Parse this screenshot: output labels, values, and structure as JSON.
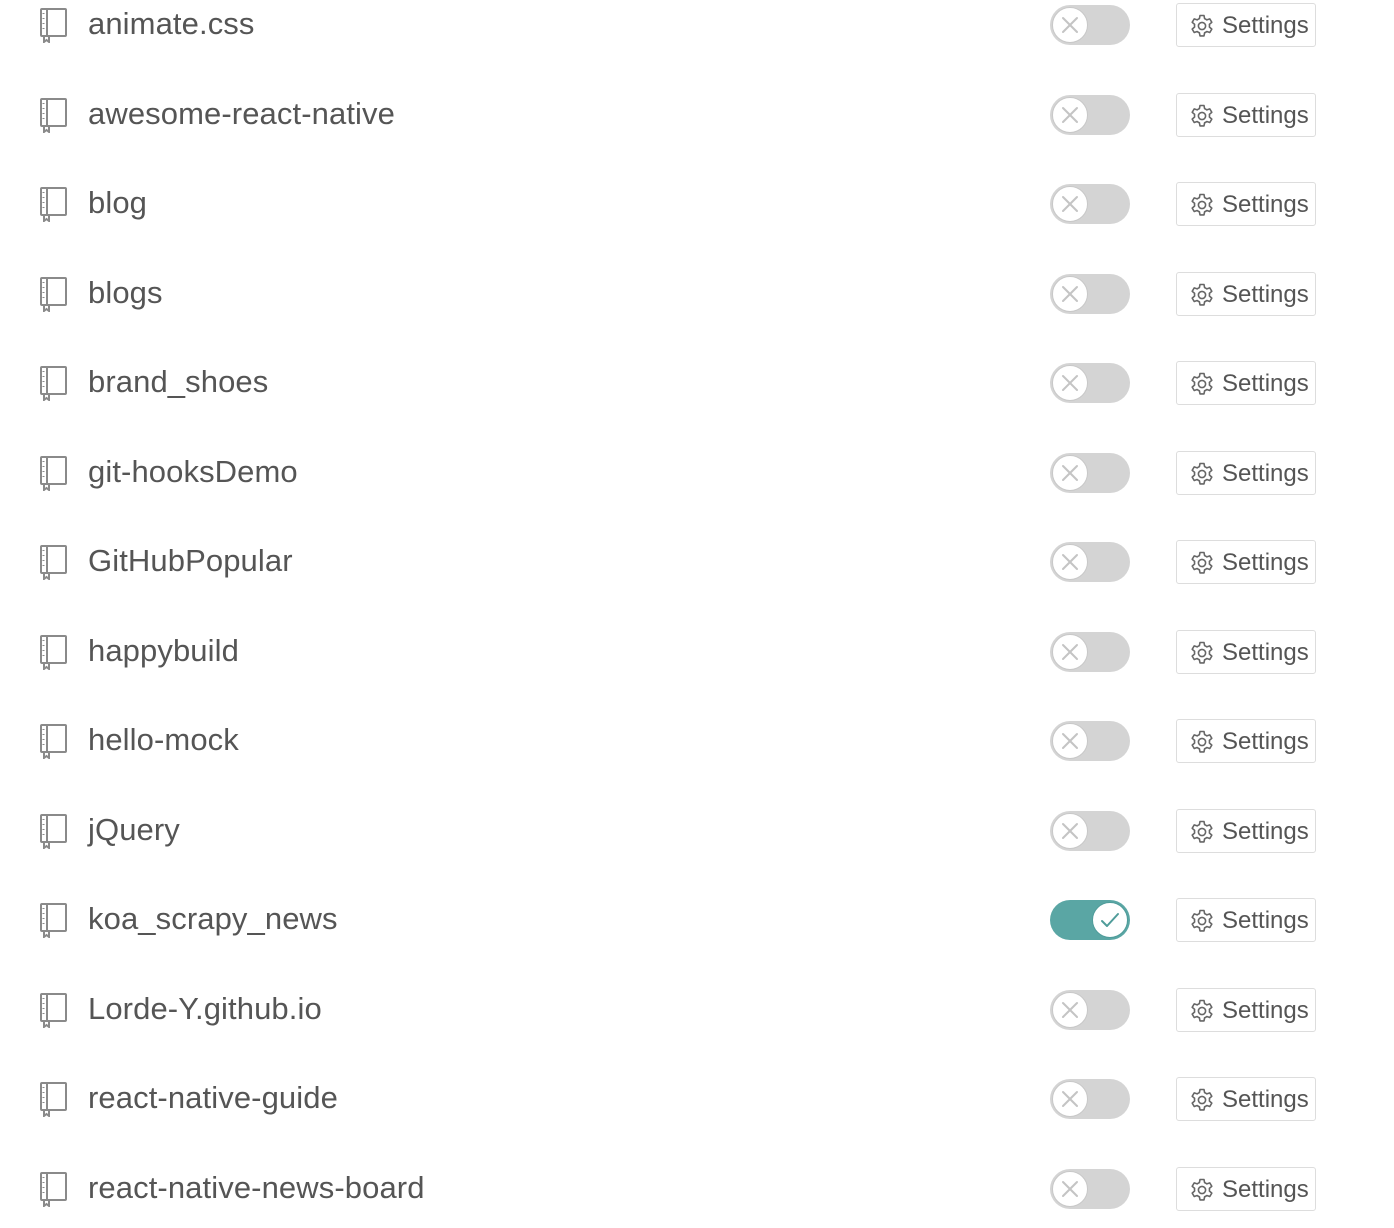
{
  "repositories": [
    {
      "name": "animate.css",
      "enabled": false,
      "settings_label": "Settings"
    },
    {
      "name": "awesome-react-native",
      "enabled": false,
      "settings_label": "Settings"
    },
    {
      "name": "blog",
      "enabled": false,
      "settings_label": "Settings"
    },
    {
      "name": "blogs",
      "enabled": false,
      "settings_label": "Settings"
    },
    {
      "name": "brand_shoes",
      "enabled": false,
      "settings_label": "Settings"
    },
    {
      "name": "git-hooksDemo",
      "enabled": false,
      "settings_label": "Settings"
    },
    {
      "name": "GitHubPopular",
      "enabled": false,
      "settings_label": "Settings"
    },
    {
      "name": "happybuild",
      "enabled": false,
      "settings_label": "Settings"
    },
    {
      "name": "hello-mock",
      "enabled": false,
      "settings_label": "Settings"
    },
    {
      "name": "jQuery",
      "enabled": false,
      "settings_label": "Settings"
    },
    {
      "name": "koa_scrapy_news",
      "enabled": true,
      "settings_label": "Settings"
    },
    {
      "name": "Lorde-Y.github.io",
      "enabled": false,
      "settings_label": "Settings"
    },
    {
      "name": "react-native-guide",
      "enabled": false,
      "settings_label": "Settings"
    },
    {
      "name": "react-native-news-board",
      "enabled": false,
      "settings_label": "Settings"
    }
  ],
  "icons": {
    "repo": "repo-book-icon",
    "toggle_off": "x-mark-icon",
    "toggle_on": "check-mark-icon",
    "settings": "gear-icon"
  },
  "colors": {
    "text": "#555555",
    "toggle_off": "#d4d4d4",
    "toggle_on": "#5aa6a4",
    "border": "#dddddd"
  }
}
